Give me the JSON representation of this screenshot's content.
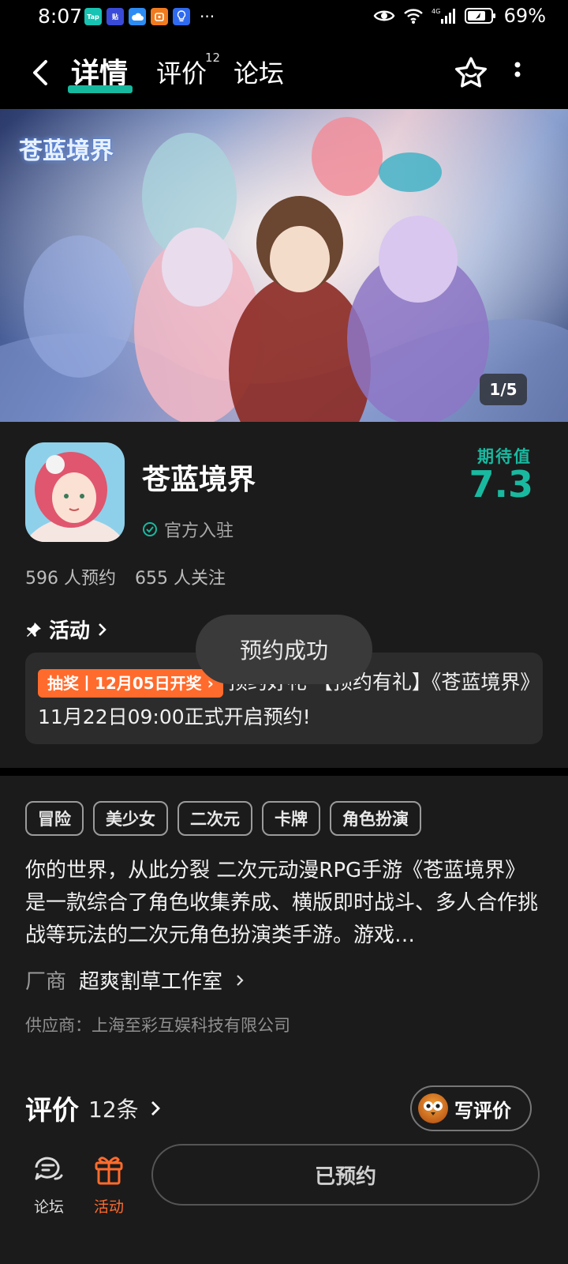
{
  "status_bar": {
    "time": "8:07",
    "battery": "69%",
    "apps": [
      {
        "icon": "taptap-icon",
        "label": "Tap",
        "color": "#17c3b2"
      },
      {
        "icon": "tieba-icon",
        "label": "贴",
        "color": "#3a4bd8"
      },
      {
        "icon": "cloud-icon",
        "label": "",
        "color": "#2c8cf4"
      },
      {
        "icon": "app-orange-icon",
        "label": "",
        "color": "#f07b1f"
      },
      {
        "icon": "bulb-icon",
        "label": "",
        "color": "#2f6bf0"
      }
    ],
    "more": "···"
  },
  "header": {
    "tabs": [
      {
        "label": "详情",
        "active": true
      },
      {
        "label": "评价",
        "badge": "12"
      },
      {
        "label": "论坛"
      }
    ]
  },
  "banner": {
    "logo_text": "苍蓝境界",
    "counter": "1/5"
  },
  "game": {
    "title": "苍蓝境界",
    "official_label": "官方入驻",
    "expect_label": "期待值",
    "expect_value": "7.3",
    "reservations": "596 人预约",
    "followers": "655 人关注"
  },
  "activity": {
    "heading": "活动",
    "tag": "抽奖丨12月05日开奖",
    "text": "预约好礼 【预约有礼】《苍蓝境界》11月22日09:00正式开启预约!"
  },
  "toast": "预约成功",
  "tags": [
    "冒险",
    "美少女",
    "二次元",
    "卡牌",
    "角色扮演"
  ],
  "description": "你的世界，从此分裂 二次元动漫RPG手游《苍蓝境界》是一款综合了角色收集养成、横版即时战斗、多人合作挑战等玩法的二次元角色扮演类手游。游戏…",
  "vendor": {
    "label": "厂商",
    "name": "超爽割草工作室"
  },
  "supplier": "供应商：上海至彩互娱科技有限公司",
  "reviews": {
    "title": "评价",
    "count": "12条",
    "write_label": "写评价"
  },
  "bottom_nav": {
    "forum": "论坛",
    "activity": "活动",
    "reserve_button": "已预约"
  },
  "colors": {
    "accent_teal": "#19b9a0",
    "accent_orange": "#ff6b2c"
  }
}
